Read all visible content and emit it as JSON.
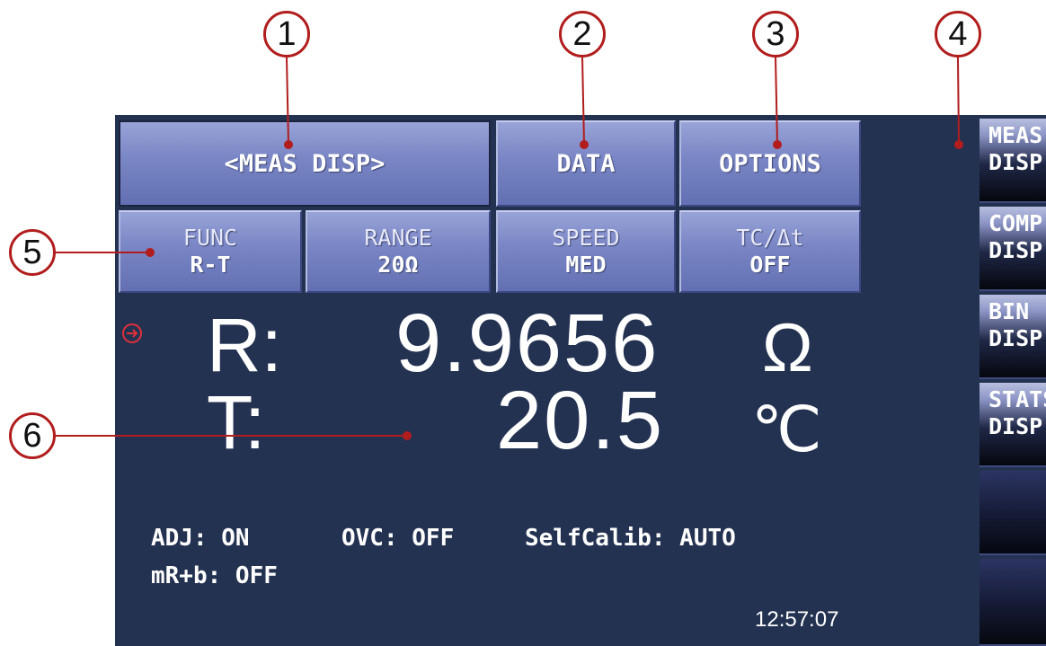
{
  "callouts": [
    "1",
    "2",
    "3",
    "4",
    "5",
    "6"
  ],
  "tabs": {
    "meas_disp": "<MEAS DISP>",
    "data": "DATA",
    "options": "OPTIONS"
  },
  "params": [
    {
      "label": "FUNC",
      "value": "R-T"
    },
    {
      "label": "RANGE",
      "value": "20Ω"
    },
    {
      "label": "SPEED",
      "value": "MED"
    },
    {
      "label": "TC/Δt",
      "value": "OFF"
    }
  ],
  "side_menu": [
    {
      "line1": "MEAS",
      "line2": "DISP"
    },
    {
      "line1": "COMP",
      "line2": "DISP"
    },
    {
      "line1": "BIN",
      "line2": "DISP"
    },
    {
      "line1": "STATS",
      "line2": "DISP"
    },
    {
      "line1": "",
      "line2": ""
    },
    {
      "line1": "",
      "line2": ""
    }
  ],
  "measurement": {
    "r_label": "R:",
    "r_value": "9.9656",
    "r_unit": "Ω",
    "t_label": "T:",
    "t_value": "20.5",
    "t_unit": "℃"
  },
  "status": {
    "adj": "ADJ: ON",
    "ovc": "OVC: OFF",
    "selfcalib": "SelfCalib: AUTO",
    "mrb": "mR+b: OFF",
    "time": "12:57:07"
  },
  "colors": {
    "screen_bg": "#243252",
    "button": "#7985c4",
    "callout": "#b11d1d",
    "indicator": "#e0303a"
  }
}
